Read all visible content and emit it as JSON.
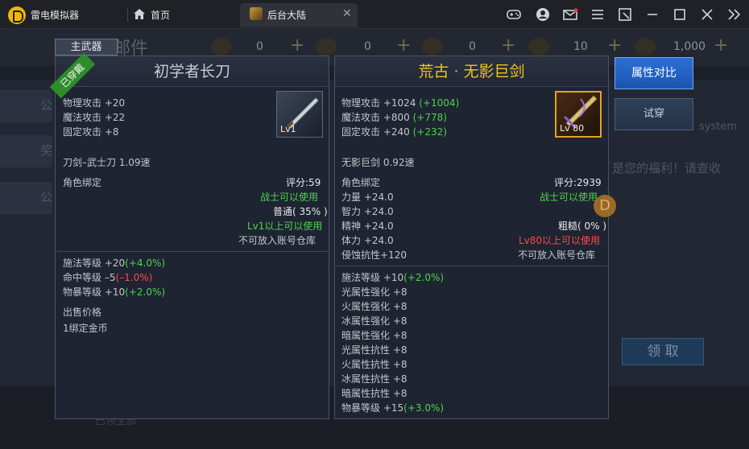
{
  "titlebar": {
    "app_name": "雷电模拟器",
    "home_label": "首页",
    "tab_label": "后台大陆",
    "icons": [
      "gamepad-icon",
      "avatar-icon",
      "mail-icon",
      "menu-icon",
      "screenshot-icon",
      "minimize-icon",
      "maximize-icon",
      "close-icon",
      "collapse-icon"
    ]
  },
  "game": {
    "screen_title": "邮件",
    "resources": [
      {
        "value": "0"
      },
      {
        "value": "0"
      },
      {
        "value": "0"
      },
      {
        "value": "10"
      },
      {
        "value": "1,000"
      }
    ],
    "bg_left_tabs": [
      "公",
      "奖",
      "公"
    ],
    "bg_system_text": "system",
    "bg_welfare_text": "是您的福利！请查收",
    "receive_button": "领 取",
    "bottom_hint": "已领全部"
  },
  "actions": {
    "compare": "属性对比",
    "try_on": "试穿"
  },
  "left_item": {
    "slot_tag": "主武器",
    "equipped_ribbon": "已穿戴",
    "name": "初学者长刀",
    "name_color": "#c9ccd2",
    "stats": [
      {
        "label": "物理攻击 +20",
        "bonus": ""
      },
      {
        "label": "魔法攻击 +22",
        "bonus": ""
      },
      {
        "label": "固定攻击 +8",
        "bonus": ""
      }
    ],
    "level": "Lv1",
    "type_speed": "刀剑–武士刀  1.09速",
    "binding": "角色绑定",
    "score": "评分:59",
    "class_req": "战士可以使用",
    "quality": "普通( 35% )",
    "level_req": "Lv1以上可以使用",
    "storage": "不可放入账号仓库",
    "extra_stats": [
      {
        "label": "施法等级 +20",
        "bonus": "(+4.0%)",
        "bonus_class": "green"
      },
      {
        "label": "命中等级 –5",
        "bonus": "(–1.0%)",
        "bonus_class": "red"
      },
      {
        "label": "物暴等级 +10",
        "bonus": "(+2.0%)",
        "bonus_class": "green"
      }
    ],
    "sell_label": "出售价格",
    "sell_value": "1绑定金币"
  },
  "right_item": {
    "name": "荒古 · 无影巨剑",
    "name_color": "#f0c419",
    "stats": [
      {
        "label": "物理攻击 +1024",
        "bonus": "(+1004)"
      },
      {
        "label": "魔法攻击 +800",
        "bonus": "(+778)"
      },
      {
        "label": "固定攻击 +240",
        "bonus": "(+232)"
      }
    ],
    "level": "Lv 80",
    "type_speed": "无影巨剑 0.92速",
    "binding": "角色绑定",
    "score": "评分:2939",
    "class_req": "战士可以使用",
    "attrs": [
      "力量 +24.0",
      "智力 +24.0",
      "精神 +24.0",
      "体力 +24.0",
      "侵蚀抗性+120"
    ],
    "quality": "粗糙( 0% )",
    "level_req": "Lv80以上可以使用",
    "storage": "不可放入账号仓库",
    "extra_first": {
      "label": "施法等级 +10",
      "bonus": "(+2.0%)"
    },
    "extra_list": [
      "光属性强化 +8",
      "火属性强化 +8",
      "冰属性强化 +8",
      "暗属性强化 +8",
      "光属性抗性 +8",
      "火属性抗性 +8",
      "冰属性抗性 +8",
      "暗属性抗性 +8"
    ],
    "extra_last": {
      "label": "物暴等级 +15",
      "bonus": "(+3.0%)"
    }
  },
  "watermark": "D"
}
